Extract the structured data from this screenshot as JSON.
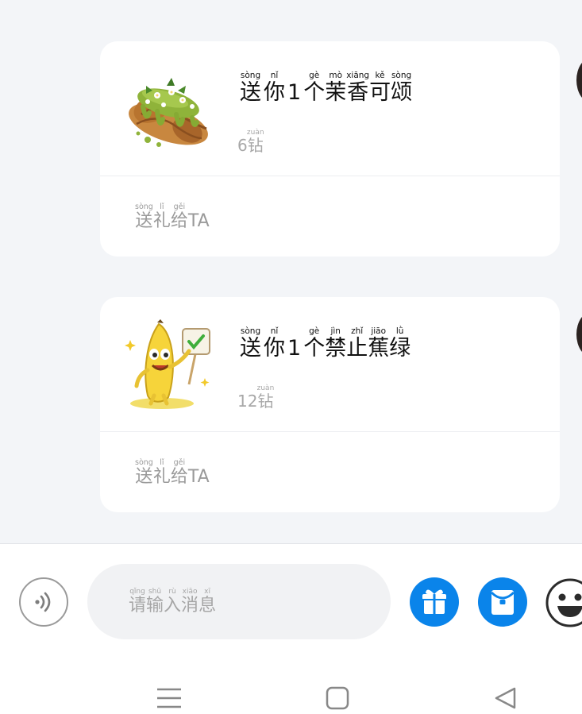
{
  "gifts": [
    {
      "image": "matcha-croissant",
      "title": {
        "prefix": [
          {
            "hanzi": "送",
            "pinyin": "sòng"
          },
          {
            "hanzi": "你",
            "pinyin": "nǐ"
          }
        ],
        "count": "1",
        "suffix": [
          {
            "hanzi": "个",
            "pinyin": "gè"
          },
          {
            "hanzi": "茉",
            "pinyin": "mò"
          },
          {
            "hanzi": "香",
            "pinyin": "xiāng"
          },
          {
            "hanzi": "可",
            "pinyin": "kě"
          },
          {
            "hanzi": "颂",
            "pinyin": "sòng"
          }
        ]
      },
      "price": {
        "amount": "6",
        "unit": {
          "hanzi": "钻",
          "pinyin": "zuàn"
        }
      },
      "action": {
        "chars": [
          {
            "hanzi": "送",
            "pinyin": "sòng"
          },
          {
            "hanzi": "礼",
            "pinyin": "lǐ"
          },
          {
            "hanzi": "给",
            "pinyin": "gěi"
          }
        ],
        "latin": "TA"
      }
    },
    {
      "image": "banana-mascot",
      "title": {
        "prefix": [
          {
            "hanzi": "送",
            "pinyin": "sòng"
          },
          {
            "hanzi": "你",
            "pinyin": "nǐ"
          }
        ],
        "count": "1",
        "suffix": [
          {
            "hanzi": "个",
            "pinyin": "gè"
          },
          {
            "hanzi": "禁",
            "pinyin": "jìn"
          },
          {
            "hanzi": "止",
            "pinyin": "zhǐ"
          },
          {
            "hanzi": "蕉",
            "pinyin": "jiāo"
          },
          {
            "hanzi": "绿",
            "pinyin": "lǜ"
          }
        ]
      },
      "price": {
        "amount": "12",
        "unit": {
          "hanzi": "钻",
          "pinyin": "zuàn"
        }
      },
      "action": {
        "chars": [
          {
            "hanzi": "送",
            "pinyin": "sòng"
          },
          {
            "hanzi": "礼",
            "pinyin": "lǐ"
          },
          {
            "hanzi": "给",
            "pinyin": "gěi"
          }
        ],
        "latin": "TA"
      }
    }
  ],
  "input_bar": {
    "voice_icon": "voice-icon",
    "placeholder": [
      {
        "hanzi": "请",
        "pinyin": "qǐng"
      },
      {
        "hanzi": "输",
        "pinyin": "shū"
      },
      {
        "hanzi": "入",
        "pinyin": "rù"
      },
      {
        "hanzi": "消",
        "pinyin": "xiāo"
      },
      {
        "hanzi": "息",
        "pinyin": "xī"
      }
    ],
    "gift_icon": "gift-icon",
    "red_packet_icon": "red-packet-icon",
    "emoji_icon": "smiley-icon"
  },
  "nav_bar": {
    "icons": [
      "menu-icon",
      "home-icon",
      "back-icon"
    ]
  },
  "colors": {
    "accent": "#0a84ea",
    "muted_text": "#a8a8a8",
    "background": "#f3f5f8"
  }
}
